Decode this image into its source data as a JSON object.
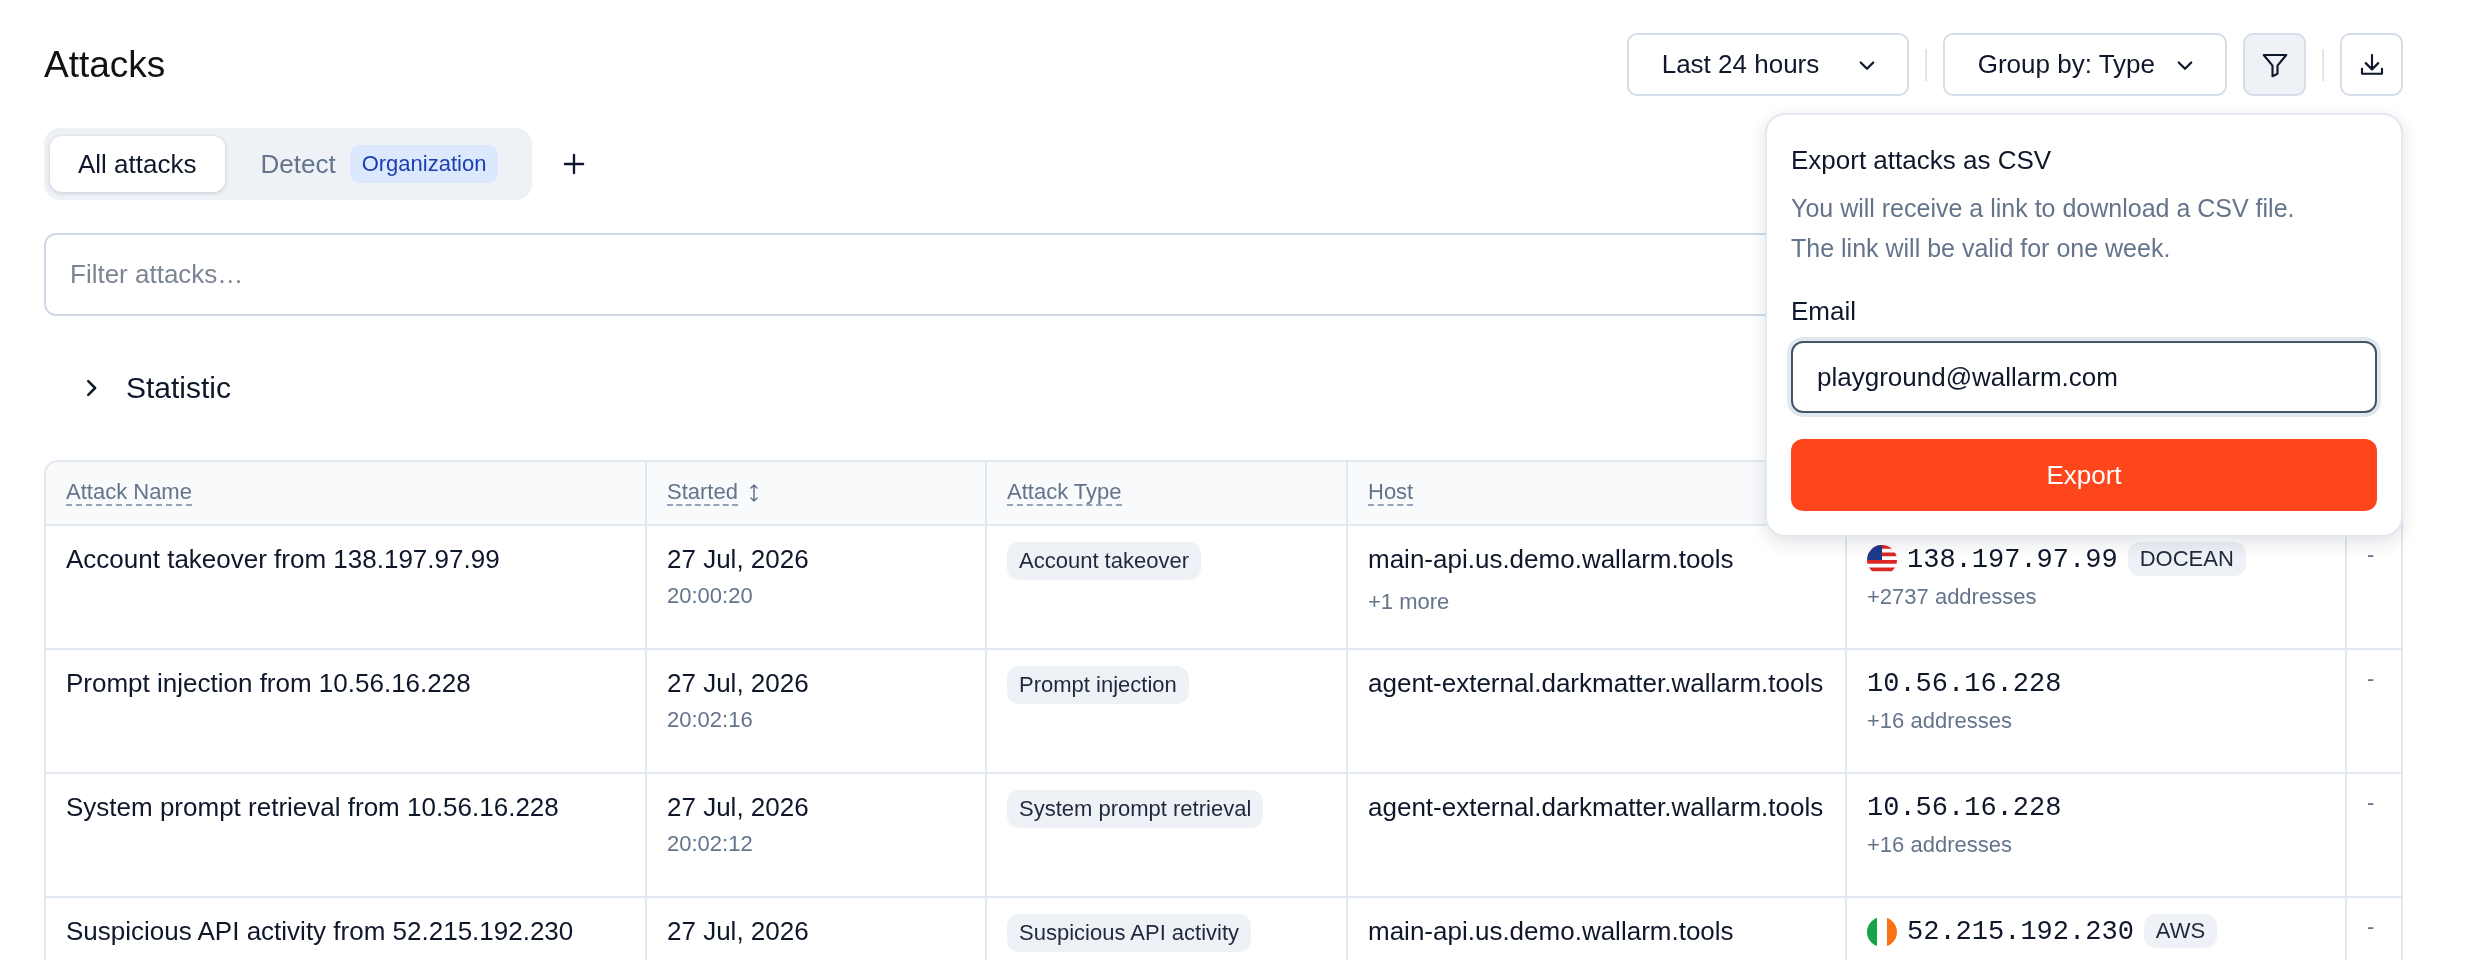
{
  "page": {
    "title": "Attacks"
  },
  "toolbar": {
    "period": "Last 24 hours",
    "group_by": "Group by: Type"
  },
  "tabs": [
    {
      "label": "All attacks",
      "selected": true
    },
    {
      "label": "Detect",
      "badge": "Organization",
      "selected": false
    }
  ],
  "filter": {
    "placeholder": "Filter attacks…"
  },
  "statistic": {
    "label": "Statistic",
    "expanded": false
  },
  "table": {
    "columns": [
      "Attack Name",
      "Started",
      "Attack Type",
      "Host"
    ],
    "rows": [
      {
        "name": "Account takeover from 138.197.97.99",
        "date": "27 Jul, 2026",
        "time": "20:00:20",
        "type": "Account takeover",
        "host": "main-api.us.demo.wallarm.tools",
        "host_more": "+1 more",
        "flag": {
          "kind": "us"
        },
        "ip": "138.197.97.99",
        "provider": "DOCEAN",
        "ip_more": "+2737 addresses",
        "column_6": "-"
      },
      {
        "name": "Prompt injection from 10.56.16.228",
        "date": "27 Jul, 2026",
        "time": "20:02:16",
        "type": "Prompt injection",
        "host": "agent-external.darkmatter.wallarm.tools",
        "ip": "10.56.16.228",
        "ip_more": "+16 addresses",
        "column_6": "-"
      },
      {
        "name": "System prompt retrieval from 10.56.16.228",
        "date": "27 Jul, 2026",
        "time": "20:02:12",
        "type": "System prompt retrieval",
        "host": "agent-external.darkmatter.wallarm.tools",
        "ip": "10.56.16.228",
        "ip_more": "+16 addresses",
        "column_6": "-"
      },
      {
        "name": "Suspicious API activity from 52.215.192.230",
        "date": "27 Jul, 2026",
        "type": "Suspicious API activity",
        "host": "main-api.us.demo.wallarm.tools",
        "flag": {
          "kind": "ie"
        },
        "ip": "52.215.192.230",
        "provider": "AWS",
        "column_6": "-"
      }
    ]
  },
  "export_popover": {
    "title": "Export attacks as CSV",
    "description": [
      "You will receive a link to download a CSV file.",
      "The link will be valid for one week."
    ],
    "email_label": "Email",
    "email_value": "playground@wallarm.com",
    "button": "Export"
  }
}
